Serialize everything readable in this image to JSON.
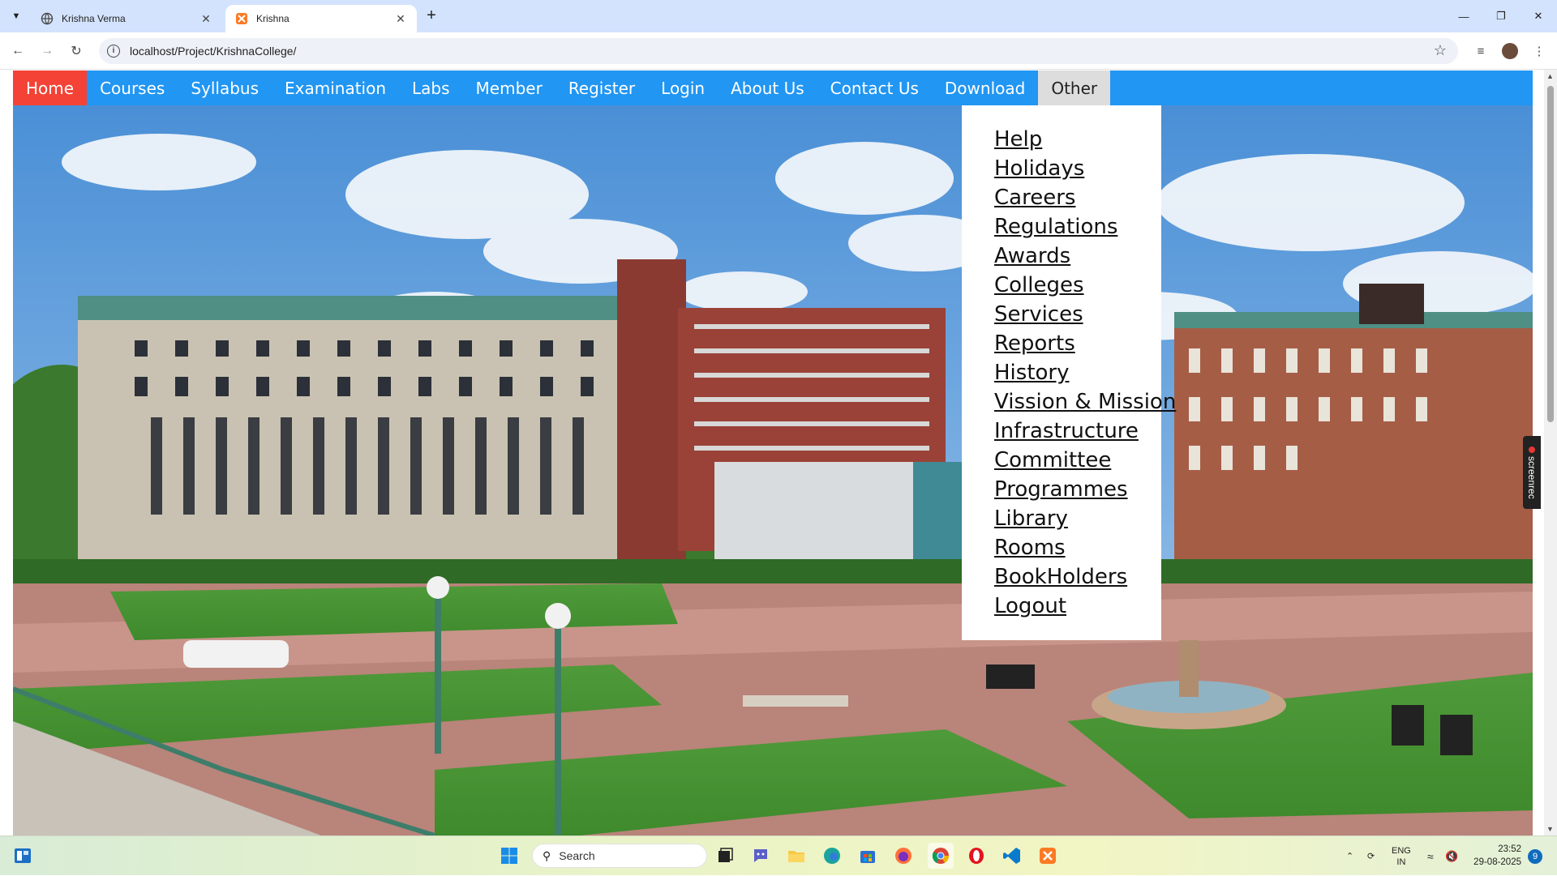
{
  "browser": {
    "tabs": [
      {
        "title": "Krishna Verma",
        "active": false
      },
      {
        "title": "Krishna",
        "active": true
      }
    ],
    "url": "localhost/Project/KrishnaCollege/"
  },
  "site_nav": {
    "items": [
      "Home",
      "Courses",
      "Syllabus",
      "Examination",
      "Labs",
      "Member",
      "Register",
      "Login",
      "About Us",
      "Contact Us",
      "Download",
      "Other"
    ],
    "active": "Home",
    "open": "Other"
  },
  "dropdown": {
    "items": [
      "Help",
      "Holidays",
      "Careers",
      "Regulations",
      "Awards",
      "Colleges",
      "Services",
      "Reports",
      "History",
      "Vission & Mission",
      "Infrastructure",
      "Committee",
      "Programmes",
      "Library",
      "Rooms",
      "BookHolders",
      "Logout"
    ]
  },
  "overlay": {
    "label": "screenrec"
  },
  "taskbar": {
    "search_placeholder": "Search",
    "lang": "ENG",
    "region": "IN",
    "time": "23:52",
    "date": "29-08-2025",
    "notification_count": "9"
  },
  "colors": {
    "nav_bg": "#2196f3",
    "nav_active": "#f44336",
    "nav_open": "#dddddd"
  }
}
